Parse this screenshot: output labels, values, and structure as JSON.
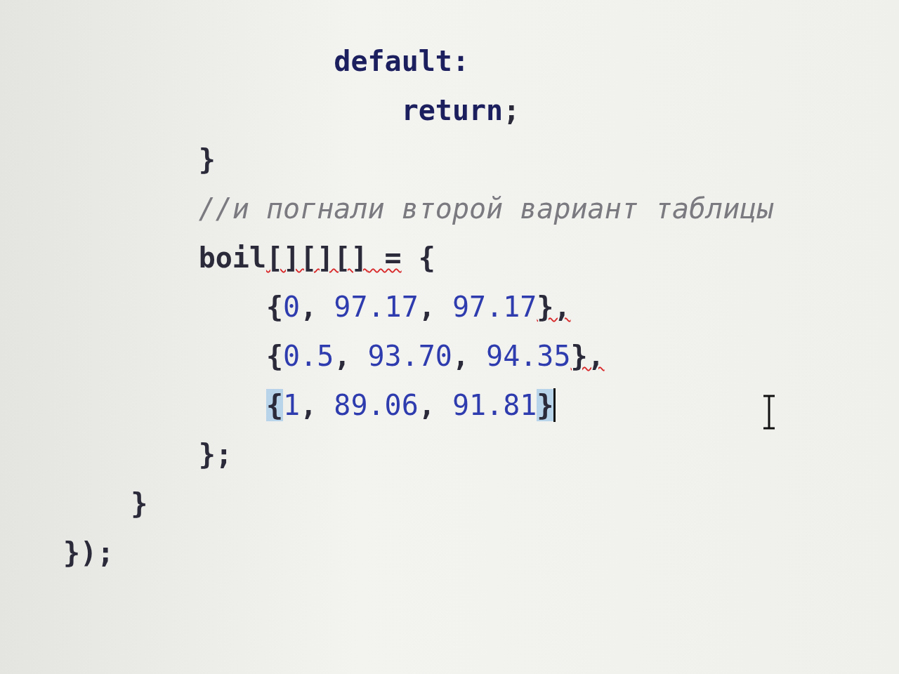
{
  "editor": {
    "lines": [
      {
        "tokens": [
          {
            "text": "                default:",
            "kind": "keyword"
          }
        ]
      },
      {
        "tokens": [
          {
            "text": "                    return",
            "kind": "keyword"
          },
          {
            "text": ";",
            "kind": "plain"
          }
        ]
      },
      {
        "tokens": [
          {
            "text": "        }",
            "kind": "plain"
          }
        ]
      },
      {
        "tokens": [
          {
            "text": "        //и погнали второй вариант таблицы",
            "kind": "comment"
          }
        ]
      },
      {
        "tokens": [
          {
            "text": "        boil",
            "kind": "plain"
          },
          {
            "text": "[][][]",
            "kind": "plain",
            "error": true
          },
          {
            "text": " =",
            "kind": "plain",
            "error": true
          },
          {
            "text": " {",
            "kind": "plain"
          }
        ]
      },
      {
        "tokens": [
          {
            "text": "            {",
            "kind": "plain"
          },
          {
            "text": "0",
            "kind": "number"
          },
          {
            "text": ", ",
            "kind": "plain"
          },
          {
            "text": "97.17",
            "kind": "number"
          },
          {
            "text": ", ",
            "kind": "plain"
          },
          {
            "text": "97.17",
            "kind": "number"
          },
          {
            "text": "},",
            "kind": "plain",
            "error": true
          }
        ]
      },
      {
        "tokens": [
          {
            "text": "            {",
            "kind": "plain"
          },
          {
            "text": "0.5",
            "kind": "number"
          },
          {
            "text": ", ",
            "kind": "plain"
          },
          {
            "text": "93.70",
            "kind": "number"
          },
          {
            "text": ", ",
            "kind": "plain"
          },
          {
            "text": "94.35",
            "kind": "number"
          },
          {
            "text": "},",
            "kind": "plain",
            "error": true
          }
        ]
      },
      {
        "tokens": [
          {
            "text": "            {",
            "kind": "plain",
            "matched": true
          },
          {
            "text": "1",
            "kind": "number"
          },
          {
            "text": ", ",
            "kind": "plain"
          },
          {
            "text": "89.06",
            "kind": "number"
          },
          {
            "text": ", ",
            "kind": "plain"
          },
          {
            "text": "91.81",
            "kind": "number"
          },
          {
            "text": "}",
            "kind": "plain",
            "matched": true
          }
        ],
        "caret": true
      },
      {
        "tokens": [
          {
            "text": "        };",
            "kind": "plain"
          }
        ]
      },
      {
        "tokens": [
          {
            "text": "    }",
            "kind": "plain"
          }
        ]
      },
      {
        "tokens": [
          {
            "text": "});",
            "kind": "plain"
          }
        ]
      }
    ]
  }
}
